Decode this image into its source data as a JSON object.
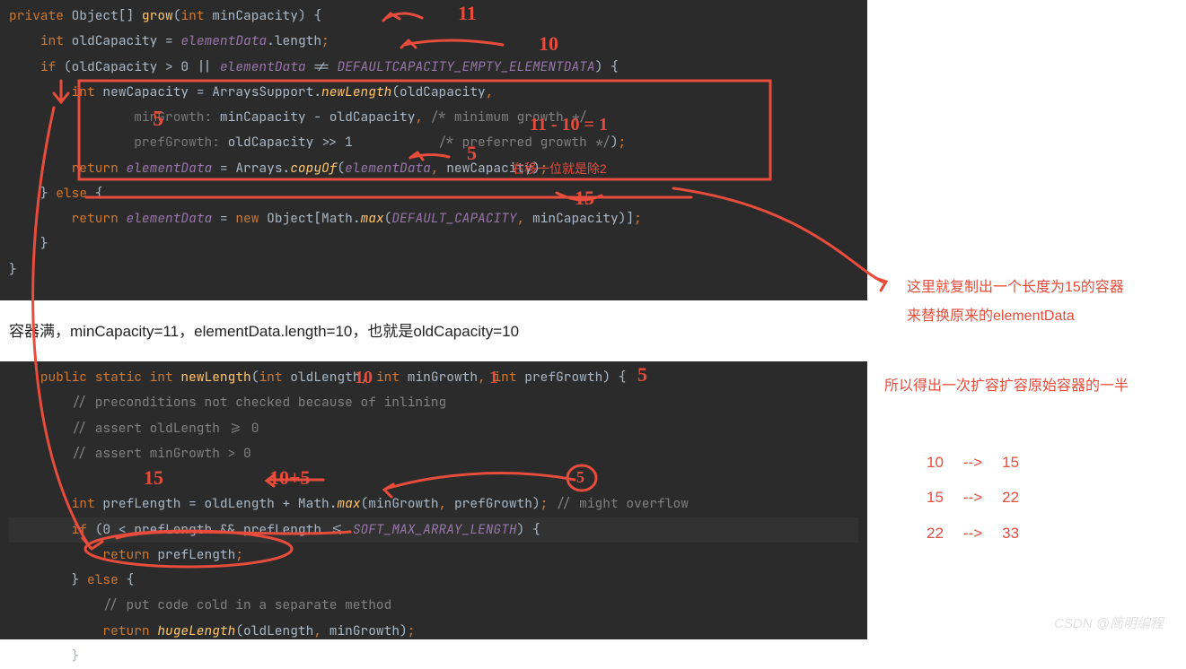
{
  "code_block_1": {
    "lines": [
      {
        "segments": [
          {
            "cls": "kw-orange",
            "t": "private "
          },
          {
            "cls": "text",
            "t": "Object[] "
          },
          {
            "cls": "kw-yellow",
            "t": "grow"
          },
          {
            "cls": "text",
            "t": "("
          },
          {
            "cls": "kw-orange",
            "t": "int "
          },
          {
            "cls": "text",
            "t": "minCapacity) {"
          }
        ]
      },
      {
        "indent": 1,
        "segments": [
          {
            "cls": "kw-orange",
            "t": "int "
          },
          {
            "cls": "text",
            "t": "oldCapacity = "
          },
          {
            "cls": "kw-purple",
            "t": "elementData"
          },
          {
            "cls": "text",
            "t": ".length"
          },
          {
            "cls": "kw-orange",
            "t": ";"
          }
        ]
      },
      {
        "indent": 1,
        "segments": [
          {
            "cls": "kw-orange",
            "t": "if "
          },
          {
            "cls": "text",
            "t": "(oldCapacity > "
          },
          {
            "cls": "text",
            "t": "0"
          },
          {
            "cls": "text",
            "t": " || "
          },
          {
            "cls": "kw-purple",
            "t": "elementData"
          },
          {
            "cls": "text",
            "t": " != "
          },
          {
            "cls": "kw-purple",
            "t": "DEFAULTCAPACITY_EMPTY_ELEMENTDATA"
          },
          {
            "cls": "text",
            "t": ") {"
          }
        ]
      },
      {
        "indent": 2,
        "segments": [
          {
            "cls": "kw-orange",
            "t": "int "
          },
          {
            "cls": "text",
            "t": "newCapacity = ArraysSupport."
          },
          {
            "cls": "kw-italic",
            "t": "newLength"
          },
          {
            "cls": "text",
            "t": "(oldCapacity"
          },
          {
            "cls": "kw-orange",
            "t": ","
          }
        ]
      },
      {
        "indent": 4,
        "segments": [
          {
            "cls": "hint",
            "t": "minGrowth: "
          },
          {
            "cls": "text",
            "t": "minCapacity - oldCapacity"
          },
          {
            "cls": "kw-orange",
            "t": ", "
          },
          {
            "cls": "comment",
            "t": "/* minimum growth */"
          }
        ]
      },
      {
        "indent": 4,
        "segments": [
          {
            "cls": "hint",
            "t": "prefGrowth: "
          },
          {
            "cls": "text",
            "t": "oldCapacity >> "
          },
          {
            "cls": "text",
            "t": "1           "
          },
          {
            "cls": "comment",
            "t": "/* preferred growth */"
          },
          {
            "cls": "text",
            "t": ")"
          },
          {
            "cls": "kw-orange",
            "t": ";"
          }
        ]
      },
      {
        "indent": 2,
        "segments": [
          {
            "cls": "kw-orange",
            "t": "return "
          },
          {
            "cls": "kw-purple",
            "t": "elementData"
          },
          {
            "cls": "text",
            "t": " = Arrays."
          },
          {
            "cls": "kw-italic",
            "t": "copyOf"
          },
          {
            "cls": "text",
            "t": "("
          },
          {
            "cls": "kw-purple",
            "t": "elementData"
          },
          {
            "cls": "kw-orange",
            "t": ", "
          },
          {
            "cls": "text",
            "t": "newCapacity)"
          },
          {
            "cls": "kw-orange",
            "t": ";"
          }
        ]
      },
      {
        "indent": 1,
        "segments": [
          {
            "cls": "text",
            "t": "} "
          },
          {
            "cls": "kw-orange",
            "t": "else "
          },
          {
            "cls": "text",
            "t": "{"
          }
        ]
      },
      {
        "indent": 2,
        "segments": [
          {
            "cls": "kw-orange",
            "t": "return "
          },
          {
            "cls": "kw-purple",
            "t": "elementData"
          },
          {
            "cls": "text",
            "t": " = "
          },
          {
            "cls": "kw-orange",
            "t": "new "
          },
          {
            "cls": "text",
            "t": "Object[Math."
          },
          {
            "cls": "kw-italic",
            "t": "max"
          },
          {
            "cls": "text",
            "t": "("
          },
          {
            "cls": "kw-purple",
            "t": "DEFAULT_CAPACITY"
          },
          {
            "cls": "kw-orange",
            "t": ", "
          },
          {
            "cls": "text",
            "t": "minCapacity)]"
          },
          {
            "cls": "kw-orange",
            "t": ";"
          }
        ]
      },
      {
        "indent": 1,
        "segments": [
          {
            "cls": "text",
            "t": "}"
          }
        ]
      },
      {
        "segments": [
          {
            "cls": "text",
            "t": "}"
          }
        ]
      }
    ]
  },
  "middle_text": "容器满，minCapacity=11，elementData.length=10，也就是oldCapacity=10",
  "code_block_2": {
    "lines": [
      {
        "segments": [
          {
            "cls": "kw-orange",
            "t": "public static int "
          },
          {
            "cls": "kw-yellow",
            "t": "newLength"
          },
          {
            "cls": "text",
            "t": "("
          },
          {
            "cls": "kw-orange",
            "t": "int "
          },
          {
            "cls": "text",
            "t": "oldLength"
          },
          {
            "cls": "kw-orange",
            "t": ", int "
          },
          {
            "cls": "text",
            "t": "minGrowth"
          },
          {
            "cls": "kw-orange",
            "t": ", int "
          },
          {
            "cls": "text",
            "t": "prefGrowth) {"
          }
        ]
      },
      {
        "indent": 1,
        "segments": [
          {
            "cls": "comment",
            "t": "// preconditions not checked because of inlining"
          }
        ]
      },
      {
        "indent": 1,
        "segments": [
          {
            "cls": "comment",
            "t": "// assert oldLength >= 0"
          }
        ]
      },
      {
        "indent": 1,
        "segments": [
          {
            "cls": "comment",
            "t": "// assert minGrowth > 0"
          }
        ]
      },
      {
        "indent": 1,
        "segments": [
          {
            "cls": "text",
            "t": ""
          }
        ]
      },
      {
        "indent": 1,
        "segments": [
          {
            "cls": "kw-orange",
            "t": "int "
          },
          {
            "cls": "text",
            "t": "prefLength = oldLength + Math."
          },
          {
            "cls": "kw-italic",
            "t": "max"
          },
          {
            "cls": "text",
            "t": "(minGrowth"
          },
          {
            "cls": "kw-orange",
            "t": ", "
          },
          {
            "cls": "text",
            "t": "prefGrowth)"
          },
          {
            "cls": "kw-orange",
            "t": "; "
          },
          {
            "cls": "comment",
            "t": "// might overflow"
          }
        ]
      },
      {
        "indent": 1,
        "hl": true,
        "segments": [
          {
            "cls": "kw-orange",
            "t": "if "
          },
          {
            "cls": "text",
            "t": "("
          },
          {
            "cls": "text",
            "t": "0"
          },
          {
            "cls": "text",
            "t": " < prefLength && prefLength <= "
          },
          {
            "cls": "kw-purple",
            "t": "SOFT_MAX_ARRAY_LENGTH"
          },
          {
            "cls": "text",
            "t": ") {"
          }
        ]
      },
      {
        "indent": 2,
        "segments": [
          {
            "cls": "kw-orange",
            "t": "return "
          },
          {
            "cls": "text",
            "t": "prefLength"
          },
          {
            "cls": "kw-orange",
            "t": ";"
          }
        ]
      },
      {
        "indent": 1,
        "segments": [
          {
            "cls": "text",
            "t": "} "
          },
          {
            "cls": "kw-orange",
            "t": "else "
          },
          {
            "cls": "text",
            "t": "{"
          }
        ]
      },
      {
        "indent": 2,
        "segments": [
          {
            "cls": "comment",
            "t": "// put code cold in a separate method"
          }
        ]
      },
      {
        "indent": 2,
        "segments": [
          {
            "cls": "kw-orange",
            "t": "return "
          },
          {
            "cls": "kw-italic",
            "t": "hugeLength"
          },
          {
            "cls": "text",
            "t": "(oldLength"
          },
          {
            "cls": "kw-orange",
            "t": ", "
          },
          {
            "cls": "text",
            "t": "minGrowth)"
          },
          {
            "cls": "kw-orange",
            "t": ";"
          }
        ]
      },
      {
        "indent": 1,
        "segments": [
          {
            "cls": "text",
            "t": "}"
          }
        ]
      }
    ]
  },
  "notes": {
    "right1_line1": "这里就复制出一个长度为15的容器",
    "right1_line2": "来替换原来的elementData",
    "right2": "所以得出一次扩容扩容原始容器的一半"
  },
  "growth_table": [
    {
      "from": "10",
      "to": "15"
    },
    {
      "from": "15",
      "to": "22"
    },
    {
      "from": "22",
      "to": "33"
    }
  ],
  "red_annotations": {
    "a11": "11",
    "a10": "10",
    "a5_left": "5",
    "a11_10_1": "11 - 10 = 1",
    "a5_shift": "5",
    "shift_note": "右移一位就是除2",
    "a15_copy": "15",
    "b10": "10",
    "b1": "1",
    "b5": "5",
    "b15": "15",
    "b105": "10+5",
    "bcircle5": "5"
  },
  "watermark": "CSDN @简明编程"
}
